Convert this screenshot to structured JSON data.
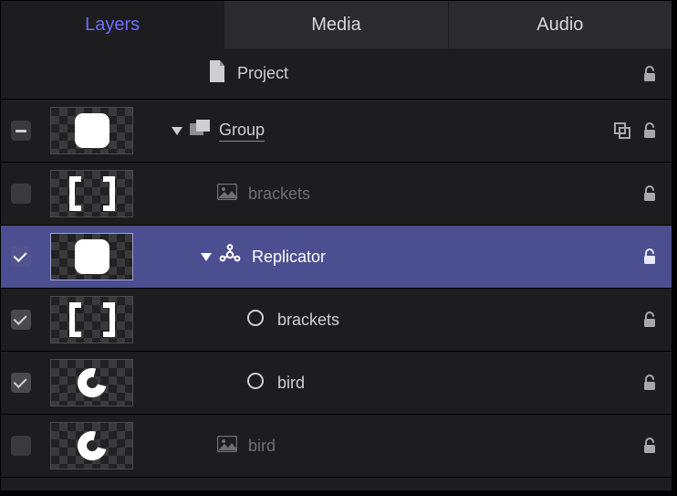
{
  "tabs": {
    "layers": "Layers",
    "media": "Media",
    "audio": "Audio",
    "active": "layers"
  },
  "rows": {
    "project": {
      "label": "Project"
    },
    "group": {
      "label": "Group"
    },
    "brackets_top": {
      "label": "brackets"
    },
    "replicator": {
      "label": "Replicator"
    },
    "brackets_rep": {
      "label": "brackets"
    },
    "bird_rep": {
      "label": "bird"
    },
    "bird_bottom": {
      "label": "bird"
    }
  },
  "colors": {
    "accent": "#6f6bff",
    "selection": "#4b4e8f"
  }
}
